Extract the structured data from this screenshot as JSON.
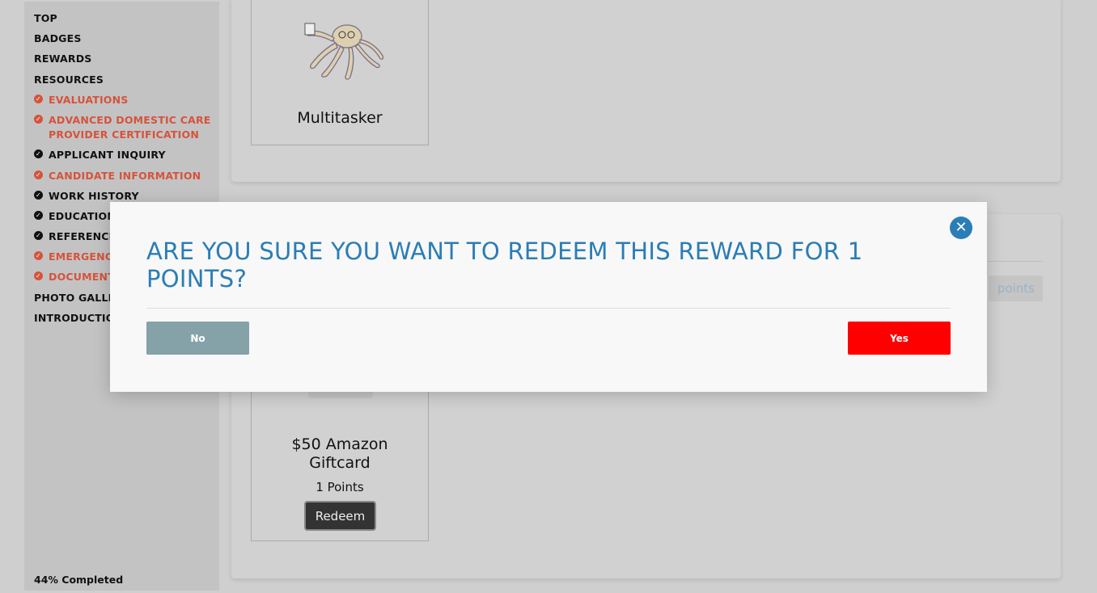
{
  "sidebar": {
    "items": [
      {
        "label": "TOP"
      },
      {
        "label": "BADGES"
      },
      {
        "label": "REWARDS"
      },
      {
        "label": "RESOURCES"
      }
    ],
    "sub_items": [
      {
        "label": "EVALUATIONS",
        "status": "incomplete"
      },
      {
        "label_line1": "ADVANCED DOMESTIC CARE",
        "label_line2": "PROVIDER CERTIFICATION",
        "status": "incomplete"
      },
      {
        "label": "APPLICANT INQUIRY",
        "status": "complete"
      },
      {
        "label": "CANDIDATE INFORMATION",
        "status": "incomplete"
      },
      {
        "label": "WORK HISTORY",
        "status": "complete"
      },
      {
        "label": "EDUCATION",
        "status": "complete"
      },
      {
        "label": "REFERENCES",
        "status": "complete"
      },
      {
        "label": "EMERGENCY",
        "status": "incomplete"
      },
      {
        "label": "DOCUMENTS",
        "status": "incomplete"
      }
    ],
    "bottom_items": [
      {
        "label": "PHOTO GALLERY"
      },
      {
        "label": "INTRODUCTION"
      }
    ],
    "progress": "44% Completed"
  },
  "badge_card": {
    "title": "Multitasker",
    "icon": "octopus-icon"
  },
  "points_label": "points",
  "reward_card": {
    "title_line1": "$50 Amazon",
    "title_line2": "Giftcard",
    "points": "1 Points",
    "redeem_label": "Redeem"
  },
  "modal": {
    "title": "ARE YOU SURE YOU WANT TO REDEEM THIS REWARD FOR 1 POINTS?",
    "no_label": "No",
    "yes_label": "Yes",
    "close_icon": "close-icon"
  },
  "colors": {
    "accent_blue": "#2b7db5",
    "incomplete_red": "#d6533a",
    "yes_red": "#ff0000",
    "no_gray": "#85a2a9"
  }
}
